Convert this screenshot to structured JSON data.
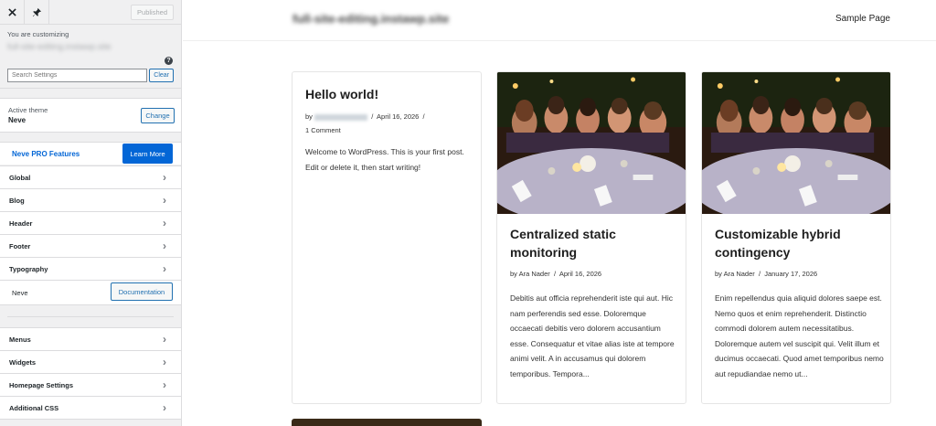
{
  "customizer": {
    "publish_label": "Published",
    "you_are_customizing": "You are customizing",
    "site_name": "full-site-editing.instawp.site",
    "search_placeholder": "Search Settings",
    "clear_label": "Clear",
    "active_theme_label": "Active theme",
    "active_theme_name": "Neve",
    "change_label": "Change",
    "pro_label": "Neve PRO Features",
    "learn_more_label": "Learn More",
    "sections_top": [
      {
        "label": "Global"
      },
      {
        "label": "Blog"
      },
      {
        "label": "Header"
      },
      {
        "label": "Footer"
      },
      {
        "label": "Typography"
      }
    ],
    "neve_label": "Neve",
    "documentation_label": "Documentation",
    "sections_bottom": [
      {
        "label": "Menus"
      },
      {
        "label": "Widgets"
      },
      {
        "label": "Homepage Settings"
      },
      {
        "label": "Additional CSS"
      }
    ]
  },
  "preview": {
    "site_title": "full-site-editing.instawp.site",
    "nav_link": "Sample Page",
    "posts": [
      {
        "title": "Hello world!",
        "meta_prefix": "by",
        "date": "April 16, 2026",
        "comments": "1 Comment",
        "excerpt": "Welcome to WordPress. This is your first post. Edit or delete it, then start writing!"
      },
      {
        "title": "Centralized static monitoring",
        "author": "by Ara Nader",
        "date": "April 16, 2026",
        "excerpt": "Debitis aut officia reprehenderit iste qui aut. Hic nam perferendis sed esse. Doloremque occaecati debitis vero dolorem accusantium esse. Consequatur et vitae alias iste at tempore animi velit. A in accusamus qui dolorem temporibus. Tempora..."
      },
      {
        "title": "Customizable hybrid contingency",
        "author": "by Ara Nader",
        "date": "January 17, 2026",
        "excerpt": "Enim repellendus quia aliquid dolores saepe est. Nemo quos et enim reprehenderit. Distinctio commodi dolorem autem necessitatibus. Doloremque autem vel suscipit qui. Velit illum et ducimus occaecati. Quod amet temporibus nemo aut repudiandae nemo ut..."
      }
    ],
    "meta_separator": "/"
  },
  "colors": {
    "accent": "#0366d6",
    "wp_blue": "#2271b1",
    "sidebar_bg": "#f0f0f1"
  }
}
